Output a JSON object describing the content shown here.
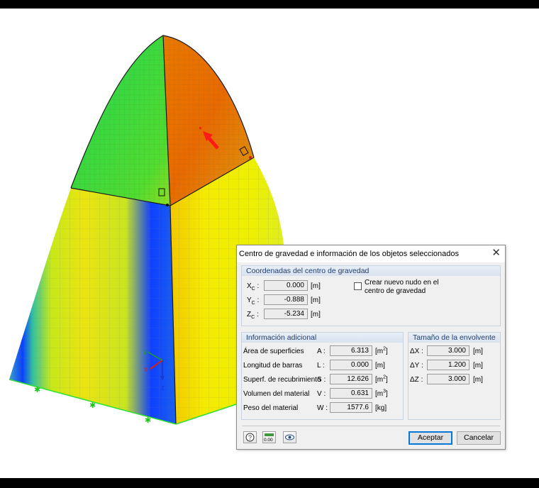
{
  "dialog": {
    "title": "Centro de gravedad e información de los objetos seleccionados",
    "close_glyph": "✕",
    "coords_group": {
      "header": "Coordenadas del centro de gravedad",
      "rows": [
        {
          "sym": "X",
          "sub": "C",
          "value": "0.000",
          "unit": "[m]"
        },
        {
          "sym": "Y",
          "sub": "C",
          "value": "-0.888",
          "unit": "[m]"
        },
        {
          "sym": "Z",
          "sub": "C",
          "value": "-5.234",
          "unit": "[m]"
        }
      ],
      "checkbox_line1": "Crear nuevo nudo en el",
      "checkbox_line2": "centro de gravedad",
      "checkbox_checked": false
    },
    "info_group": {
      "header": "Información adicional",
      "rows": [
        {
          "label": "Área de superficies",
          "sym": "A :",
          "value": "6.313",
          "unit": "[m",
          "sup": "2",
          "unit_end": "]"
        },
        {
          "label": "Longitud de barras",
          "sym": "L :",
          "value": "0.000",
          "unit": "[m]",
          "sup": "",
          "unit_end": ""
        },
        {
          "label": "Superf. de recubrimiento",
          "sym": "S :",
          "value": "12.626",
          "unit": "[m",
          "sup": "2",
          "unit_end": "]"
        },
        {
          "label": "Volumen del material",
          "sym": "V :",
          "value": "0.631",
          "unit": "[m",
          "sup": "3",
          "unit_end": "]"
        },
        {
          "label": "Peso del material",
          "sym": "W :",
          "value": "1577.6",
          "unit": "[kg]",
          "sup": "",
          "unit_end": ""
        }
      ]
    },
    "envelope_group": {
      "header": "Tamaño de la envolvente",
      "rows": [
        {
          "sym": "ΔX :",
          "value": "3.000",
          "unit": "[m]"
        },
        {
          "sym": "ΔY :",
          "value": "1.200",
          "unit": "[m]"
        },
        {
          "sym": "ΔZ :",
          "value": "3.000",
          "unit": "[m]"
        }
      ]
    },
    "footer": {
      "icons": [
        "help-icon",
        "decimal-places-icon",
        "view-icon"
      ],
      "decimal_icon_text": "0.00",
      "ok_label": "Aceptar",
      "cancel_label": "Cancelar"
    }
  },
  "viewport": {
    "axis_labels": {
      "x": "X",
      "y": "Y",
      "z": "Z"
    },
    "colors": {
      "blue": "#0033ff",
      "cyan": "#00c8e0",
      "green": "#2ed82e",
      "yellow": "#f0f000",
      "orange": "#f06a00",
      "red": "#ff1a1a"
    }
  }
}
